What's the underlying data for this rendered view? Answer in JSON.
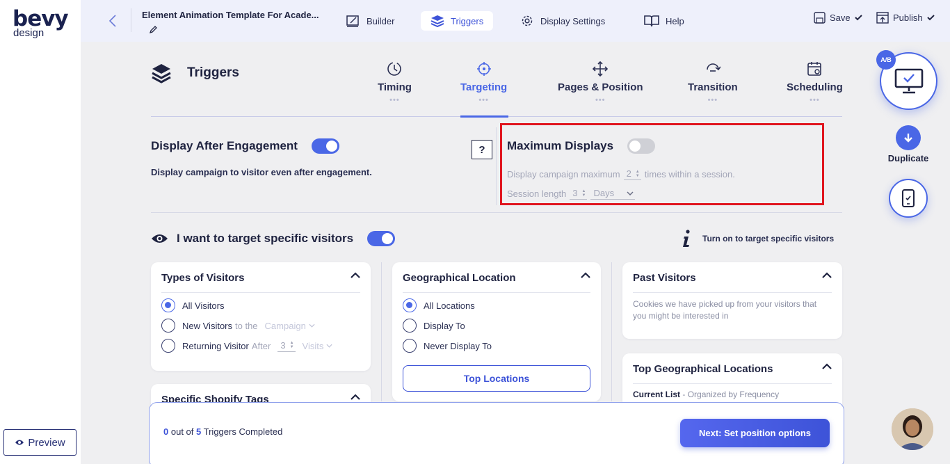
{
  "brand": {
    "name": "bevy",
    "sub": "design"
  },
  "sidebar": {
    "preview_label": "Preview"
  },
  "header": {
    "doc_title": "Element Animation Template For Acade...",
    "nav": [
      {
        "label": "Builder",
        "icon": "builder-icon"
      },
      {
        "label": "Triggers",
        "icon": "layers-icon",
        "active": true
      },
      {
        "label": "Display Settings",
        "icon": "gear-icon"
      },
      {
        "label": "Help",
        "icon": "book-icon"
      }
    ],
    "save_label": "Save",
    "publish_label": "Publish"
  },
  "page": {
    "title": "Triggers"
  },
  "tabs": [
    {
      "label": "Timing",
      "icon": "clock-icon"
    },
    {
      "label": "Targeting",
      "icon": "target-icon",
      "active": true
    },
    {
      "label": "Pages & Position",
      "icon": "move-icon"
    },
    {
      "label": "Transition",
      "icon": "transition-icon"
    },
    {
      "label": "Scheduling",
      "icon": "calendar-icon"
    }
  ],
  "engagement": {
    "title": "Display After Engagement",
    "enabled": true,
    "description": "Display campaign to visitor even after engagement.",
    "help": "?"
  },
  "max_displays": {
    "title": "Maximum Displays",
    "enabled": false,
    "prefix": "Display campaign maximum",
    "times_value": "2",
    "suffix": "times within a session.",
    "session_label": "Session length",
    "session_value": "3",
    "session_unit": "Days"
  },
  "targeting": {
    "title": "I want to target specific visitors",
    "enabled": true,
    "hint": "Turn on to target specific visitors"
  },
  "types_of_visitors": {
    "title": "Types of Visitors",
    "options": {
      "all": "All Visitors",
      "new": "New Visitors",
      "new_mid": "to the",
      "new_select": "Campaign",
      "returning": "Returning Visitor",
      "returning_mid": "After",
      "returning_value": "3",
      "returning_unit": "Visits"
    },
    "selected": "all"
  },
  "shopify": {
    "title": "Specific Shopify Tags"
  },
  "geo": {
    "title": "Geographical Location",
    "options": [
      "All Locations",
      "Display To",
      "Never Display To"
    ],
    "selected": 0,
    "button": "Top Locations"
  },
  "past_visitors": {
    "title": "Past Visitors",
    "description": "Cookies we have picked up from your visitors that you might be interested in"
  },
  "top_geo": {
    "title": "Top Geographical Locations",
    "current_list": "Current List",
    "organized": "- Organized by Frequency"
  },
  "progress": {
    "completed": "0",
    "of": "out of",
    "total": "5",
    "label": "Triggers Completed",
    "next_button": "Next: Set position options"
  },
  "right_rail": {
    "ab_label": "A/B",
    "duplicate_label": "Duplicate"
  },
  "colors": {
    "accent": "#4a67e6",
    "highlight": "#e0161f",
    "text": "#1f2340"
  }
}
